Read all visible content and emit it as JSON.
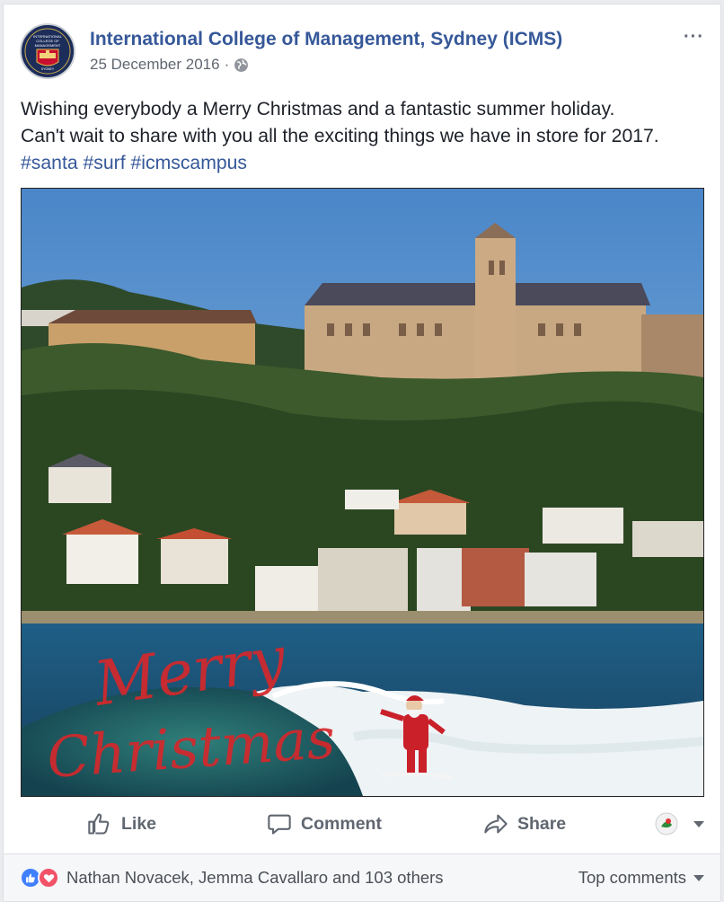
{
  "post": {
    "page_name": "International College of Management, Sydney (ICMS)",
    "avatar_lines": [
      "INTERNATIONAL",
      "COLLEGE OF",
      "MANAGEMENT",
      "SYDNEY"
    ],
    "date": "25 December 2016",
    "separator": "·",
    "audience_icon": "globe-icon",
    "more_icon": "···",
    "text_line1": "Wishing everybody a Merry Christmas and a fantastic summer holiday.",
    "text_line2": "Can't wait to share with you all the exciting things we have in store for 2017.",
    "hashtags": [
      "#santa",
      "#surf",
      "#icmscampus"
    ],
    "photo_overlay": [
      "Merry",
      "Christmas"
    ]
  },
  "actions": {
    "like_label": "Like",
    "comment_label": "Comment",
    "share_label": "Share",
    "like_icon": "thumbs-up-icon",
    "comment_icon": "speech-bubble-icon",
    "share_icon": "share-arrow-icon"
  },
  "reactions": {
    "icons": [
      "like-icon",
      "love-icon"
    ],
    "summary": "Nathan Novacek, Jemma Cavallaro and 103 others",
    "sort_label": "Top comments"
  },
  "colors": {
    "link": "#365899",
    "like": "#4080ff",
    "love": "#f25268",
    "text": "#1d2129",
    "muted": "#606770"
  }
}
